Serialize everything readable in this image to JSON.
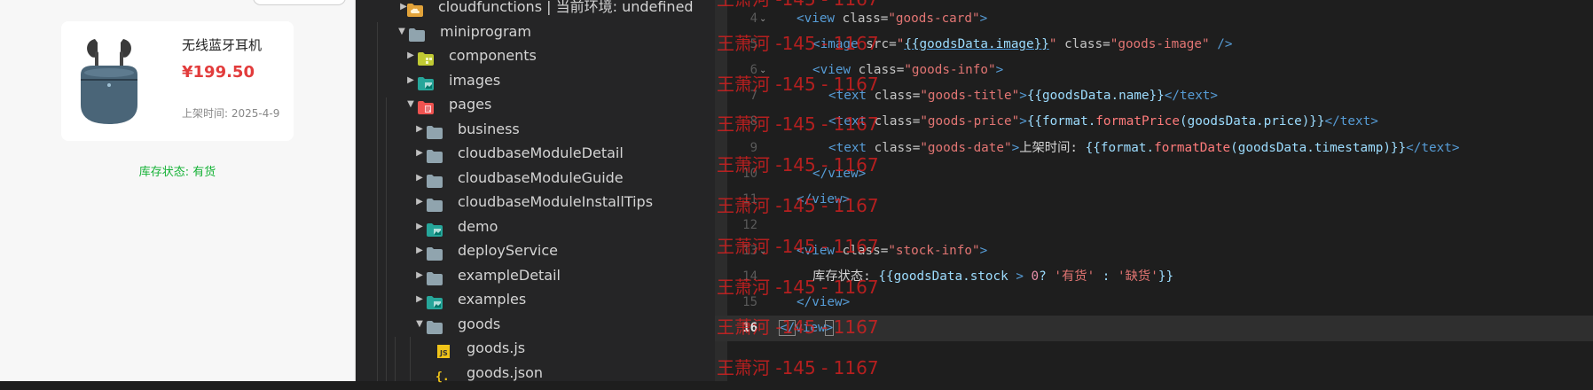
{
  "preview": {
    "goods_title": "无线蓝牙耳机",
    "goods_price": "¥199.50",
    "goods_date": "上架时间: 2025-4-9",
    "stock_status": "库存状态: 有货"
  },
  "explorer": {
    "items": [
      {
        "label": "cloudfunctions | 当前环境: undefined",
        "icon": "folder-cloud-icon",
        "expanded": false
      },
      {
        "label": "miniprogram",
        "icon": "folder-icon",
        "expanded": true
      },
      {
        "label": "components",
        "icon": "folder-components-icon",
        "expanded": false
      },
      {
        "label": "images",
        "icon": "folder-images-icon",
        "expanded": false
      },
      {
        "label": "pages",
        "icon": "folder-pages-icon",
        "expanded": true
      },
      {
        "label": "business",
        "icon": "folder-icon",
        "expanded": false
      },
      {
        "label": "cloudbaseModuleDetail",
        "icon": "folder-icon",
        "expanded": false
      },
      {
        "label": "cloudbaseModuleGuide",
        "icon": "folder-icon",
        "expanded": false
      },
      {
        "label": "cloudbaseModuleInstallTips",
        "icon": "folder-icon",
        "expanded": false
      },
      {
        "label": "demo",
        "icon": "folder-images-icon",
        "expanded": false
      },
      {
        "label": "deployService",
        "icon": "folder-icon",
        "expanded": false
      },
      {
        "label": "exampleDetail",
        "icon": "folder-icon",
        "expanded": false
      },
      {
        "label": "examples",
        "icon": "folder-images-icon",
        "expanded": false
      },
      {
        "label": "goods",
        "icon": "folder-icon",
        "expanded": true
      },
      {
        "label": "goods.js",
        "icon": "js-file-icon"
      },
      {
        "label": "goods.json",
        "icon": "json-file-icon"
      }
    ]
  },
  "editor": {
    "line_numbers": [
      "4",
      "5",
      "6",
      "7",
      "8",
      "9",
      "10",
      "11",
      "12",
      "13",
      "14",
      "15",
      "16"
    ],
    "active_line": "16",
    "tokens": {
      "lt": "<",
      "gt": ">",
      "close_lt": "</",
      "self_close": " />",
      "view": "view",
      "text": "text",
      "image": "image",
      "class_eq": " class=",
      "src_eq": " src=",
      "q_goods_card": "\"goods-card\"",
      "q_goods_image": "\"goods-image\"",
      "q_goods_info": "\"goods-info\"",
      "q_goods_title": "\"goods-title\"",
      "q_goods_price": "\"goods-price\"",
      "q_goods_date": "\"goods-date\"",
      "q_stock_info": "\"stock-info\"",
      "q": "\"",
      "exp_image": "{{goodsData.image}}",
      "exp_name": "{{goodsData.name}}",
      "exp_open_format": "{{format.",
      "fn_price": "formatPrice",
      "arg_price": "(goodsData.price)}}",
      "fn_date": "formatDate",
      "arg_date": "(goodsData.timestamp)}}",
      "date_label": "上架时间: ",
      "stock_label": "库存状态: ",
      "stock_exp_open": "{{goodsData.stock ",
      "stock_gt": ">",
      "stock_zero": " 0",
      "stock_q": "? ",
      "stock_yes": "'有货'",
      "stock_colon": " : ",
      "stock_no": "'缺货'",
      "stock_close": "}}"
    }
  },
  "watermark": "王萧河 -145 - 1167"
}
